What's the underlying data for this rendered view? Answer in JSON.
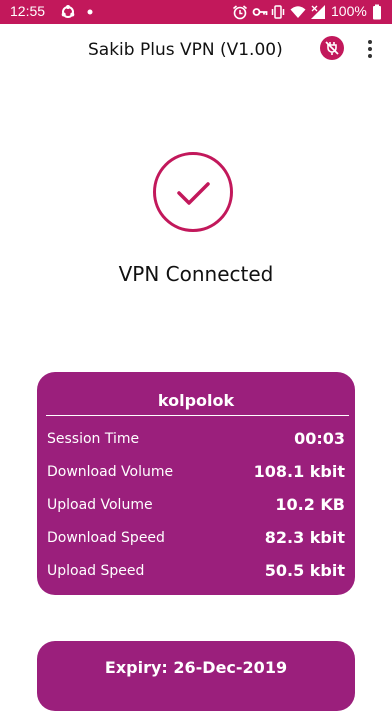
{
  "status_bar": {
    "time": "12:55",
    "battery": "100%",
    "icons": [
      "sync-icon",
      "dot-icon",
      "alarm-icon",
      "vpn-key-icon",
      "vibrate-icon",
      "wifi-icon",
      "signal-icon",
      "battery-icon"
    ]
  },
  "toolbar": {
    "title": "Sakib Plus VPN (V1.00)",
    "actions": [
      "disconnect-icon",
      "more-vert-icon"
    ]
  },
  "connection": {
    "status": "VPN Connected",
    "icon": "checkmark-icon",
    "accent_color": "#c2185b"
  },
  "stats": {
    "server": "kolpolok",
    "rows": [
      {
        "label": "Session Time",
        "value": "00:03"
      },
      {
        "label": "Download Volume",
        "value": "108.1 kbit"
      },
      {
        "label": "Upload Volume",
        "value": "10.2 KB"
      },
      {
        "label": "Download Speed",
        "value": "82.3 kbit"
      },
      {
        "label": "Upload Speed",
        "value": "50.5 kbit"
      }
    ],
    "card_color": "#9b1f7c"
  },
  "expiry": {
    "text": "Expiry: 26-Dec-2019"
  }
}
